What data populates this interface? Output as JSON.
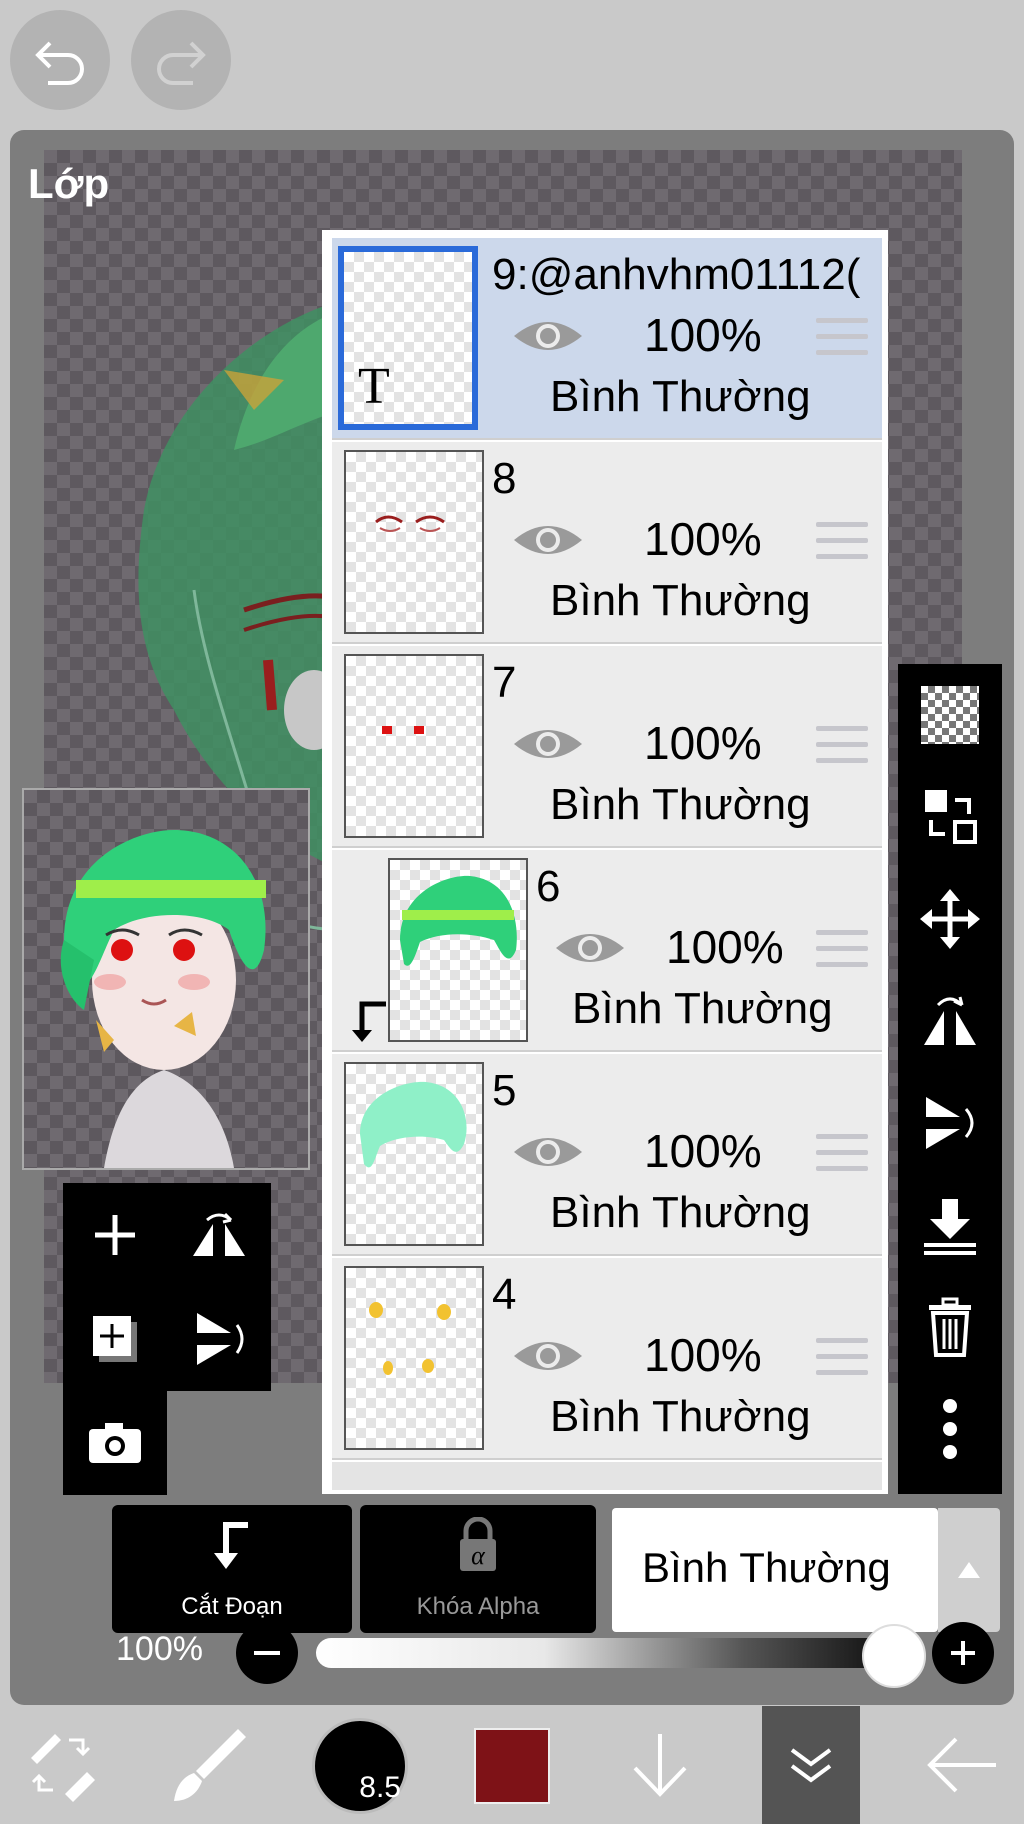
{
  "panel": {
    "title": "Lớp"
  },
  "layers": [
    {
      "name": "9:@anhvhm01112(",
      "opacity": "100%",
      "blend": "Bình Thường",
      "selected": true
    },
    {
      "name": "8",
      "opacity": "100%",
      "blend": "Bình Thường"
    },
    {
      "name": "7",
      "opacity": "100%",
      "blend": "Bình Thường"
    },
    {
      "name": "6",
      "opacity": "100%",
      "blend": "Bình Thường",
      "clipped": true
    },
    {
      "name": "5",
      "opacity": "100%",
      "blend": "Bình Thường"
    },
    {
      "name": "4",
      "opacity": "100%",
      "blend": "Bình Thường"
    }
  ],
  "thumb_text": {
    "layer9_glyph": "T"
  },
  "bottom_actions": {
    "clip_label": "Cắt Đoạn",
    "alpha_lock_label": "Khóa Alpha",
    "blend_mode_value": "Bình Thường"
  },
  "opacity_slider": {
    "label": "100%",
    "value": 1.0
  },
  "toolbar": {
    "brush_size": "8.5",
    "color": "#7e1217"
  },
  "colors": {
    "selection": "#2a6ad9",
    "panel": "#7d7d7d"
  }
}
